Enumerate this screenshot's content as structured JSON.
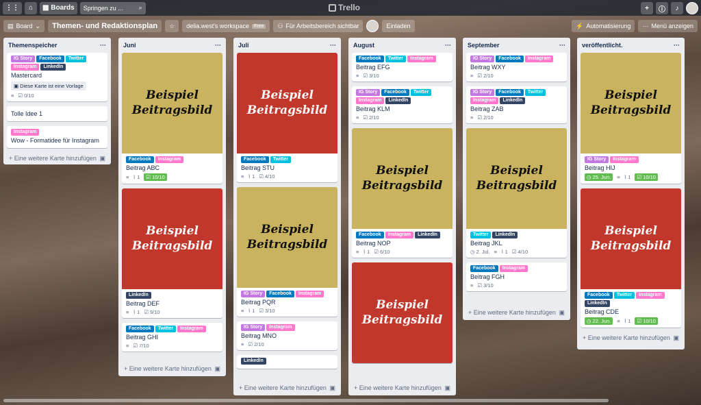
{
  "topbar": {
    "boards_label": "Boards",
    "search_placeholder": "Springen zu ...",
    "logo": "Trello"
  },
  "boardbar": {
    "view_label": "Board",
    "title": "Themen- und Redaktionsplan",
    "workspace": "delia.west's workspace",
    "workspace_badge": "Free",
    "visibility": "Für Arbeitsbereich sichtbar",
    "invite": "Einladen",
    "automation": "Automatisierung",
    "show_menu": "Menü anzeigen"
  },
  "label_colors": {
    "IG Story": "#c377e0",
    "Facebook": "#0079bf",
    "Twitter": "#00c2e0",
    "Instagram": "#ff78cb",
    "LinkedIn": "#344563"
  },
  "add_card": "Eine weitere Karte hinzufügen",
  "cover_text": "Beispiel Beitragsbild",
  "lists": [
    {
      "title": "Themenspeicher",
      "cards": [
        {
          "labels": [
            "IG Story",
            "Facebook",
            "Twitter",
            "Instagram",
            "LinkedIn"
          ],
          "title": "Mastercard",
          "template": "Diese Karte ist eine Vorlage",
          "checklist": "0/10"
        },
        {
          "labels": [],
          "title": "Tolle Idee 1"
        },
        {
          "labels": [
            "Instagram"
          ],
          "title": "Wow - Formatidee für Instagram"
        }
      ]
    },
    {
      "title": "Juni",
      "cards": [
        {
          "cover": "gold",
          "labels": [
            "Facebook",
            "Instagram"
          ],
          "title": "Beitrag ABC",
          "attachments": "1",
          "checklist": "10/10",
          "done": true
        },
        {
          "cover": "red",
          "labels": [
            "LinkedIn"
          ],
          "title": "Beitrag DEF",
          "attachments": "1",
          "checklist": "9/10"
        },
        {
          "labels": [
            "Facebook",
            "Twitter",
            "Instagram"
          ],
          "title": "Beitrag GHI",
          "checklist": "7/10"
        }
      ]
    },
    {
      "title": "Juli",
      "cards": [
        {
          "cover": "red",
          "labels": [
            "Facebook",
            "Twitter"
          ],
          "title": "Beitrag STU",
          "attachments": "1",
          "checklist": "4/10"
        },
        {
          "cover": "gold",
          "labels": [
            "IG Story",
            "Facebook",
            "Instagram"
          ],
          "title": "Beitrag PQR",
          "attachments": "1",
          "checklist": "3/10"
        },
        {
          "labels": [
            "IG Story",
            "Instagram"
          ],
          "title": "Beitrag MNO",
          "checklist": "2/10"
        },
        {
          "labels": [
            "LinkedIn"
          ],
          "title": ""
        }
      ]
    },
    {
      "title": "August",
      "cards": [
        {
          "labels": [
            "Facebook",
            "Twitter",
            "Instagram"
          ],
          "title": "Beitrag EFG",
          "checklist": "3/10"
        },
        {
          "labels": [
            "IG Story",
            "Facebook",
            "Twitter",
            "Instagram",
            "LinkedIn"
          ],
          "title": "Beitrag KLM",
          "checklist": "2/10"
        },
        {
          "cover": "gold",
          "labels": [
            "Facebook",
            "Instagram",
            "LinkedIn"
          ],
          "title": "Beitrag NOP",
          "attachments": "1",
          "checklist": "6/10"
        },
        {
          "cover": "red",
          "labels": [],
          "title": ""
        }
      ]
    },
    {
      "title": "September",
      "cards": [
        {
          "labels": [
            "IG Story",
            "Facebook",
            "Instagram"
          ],
          "title": "Beitrag WXY",
          "checklist": "2/10"
        },
        {
          "labels": [
            "IG Story",
            "Facebook",
            "Twitter",
            "Instagram",
            "LinkedIn"
          ],
          "title": "Beitrag ZAB",
          "checklist": "2/10"
        },
        {
          "cover": "gold",
          "labels": [
            "Twitter",
            "LinkedIn"
          ],
          "title": "Beitrag JKL",
          "date": "2. Jul.",
          "attachments": "1",
          "checklist": "4/10"
        },
        {
          "labels": [
            "Facebook",
            "Instagram"
          ],
          "title": "Beitrag FGH",
          "checklist": "3/10"
        }
      ]
    },
    {
      "title": "veröffentlicht.",
      "cards": [
        {
          "cover": "gold",
          "labels": [
            "IG Story",
            "Instagram"
          ],
          "title": "Beitrag HIJ",
          "date": "25. Jun.",
          "datedone": true,
          "attachments": "1",
          "checklist": "10/10",
          "done": true
        },
        {
          "cover": "red",
          "labels": [
            "Facebook",
            "Twitter",
            "Instagram",
            "LinkedIn"
          ],
          "title": "Beitrag CDE",
          "date": "22. Jun.",
          "datedone": true,
          "attachments": "1",
          "checklist": "10/10",
          "done": true
        }
      ]
    }
  ]
}
